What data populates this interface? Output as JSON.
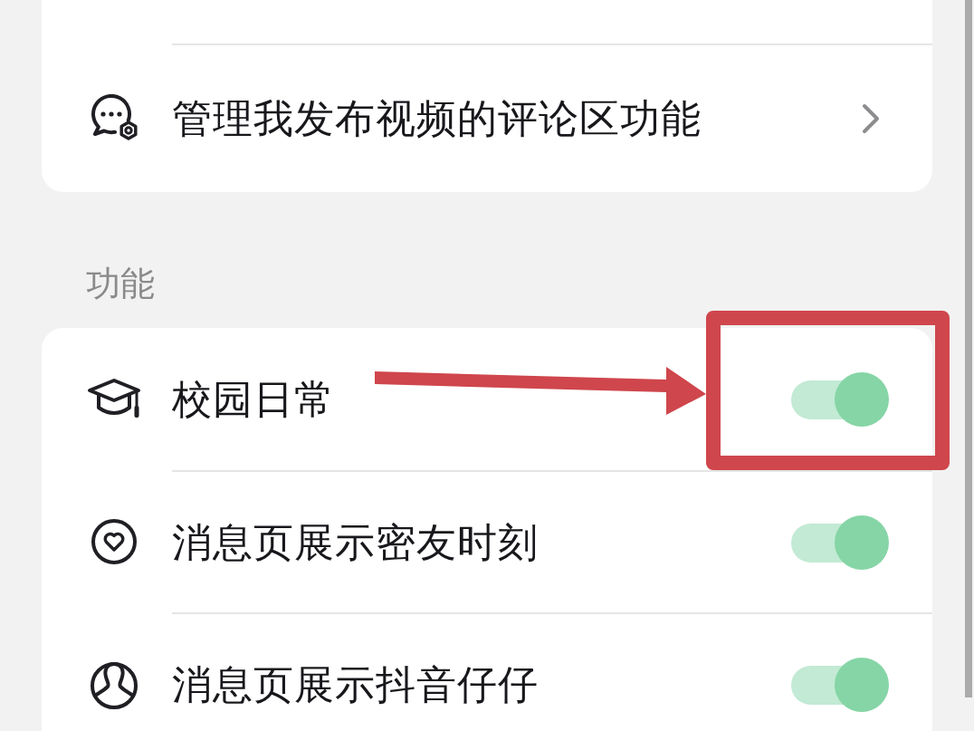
{
  "groups": [
    {
      "rows": [
        {
          "kind": "link",
          "label": "管理我发布视频的评论区功能"
        }
      ]
    },
    {
      "title": "功能",
      "rows": [
        {
          "kind": "toggle",
          "label": "校园日常",
          "on": true,
          "highlighted": true
        },
        {
          "kind": "toggle",
          "label": "消息页展示密友时刻",
          "on": true,
          "highlighted": false
        },
        {
          "kind": "toggle",
          "label": "消息页展示抖音仔仔",
          "on": true,
          "highlighted": false
        }
      ]
    }
  ]
}
